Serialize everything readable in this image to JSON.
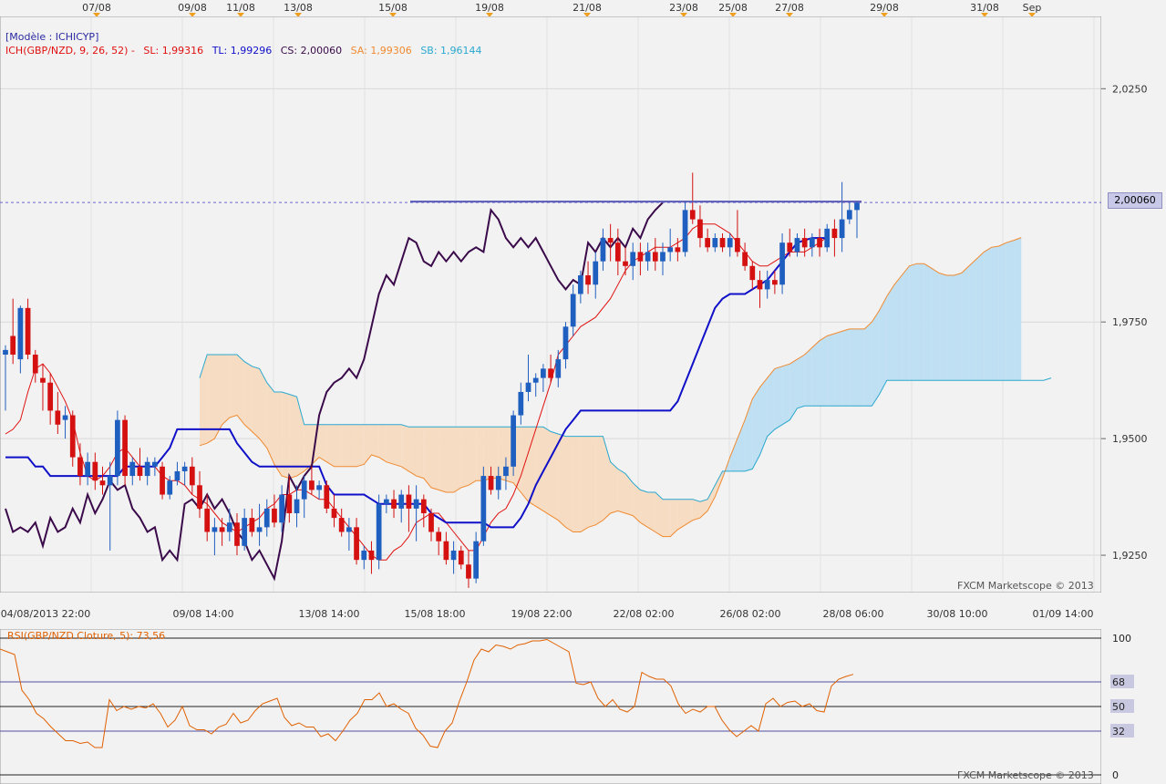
{
  "top_dates": [
    "07/08",
    "09/08",
    "11/08",
    "13/08",
    "15/08",
    "19/08",
    "21/08",
    "23/08",
    "25/08",
    "27/08",
    "29/08",
    "31/08",
    "Sep"
  ],
  "legend": {
    "model": "[Modèle : ICHICYP]",
    "ich": "ICH(GBP/NZD, 9, 26, 52) -",
    "sl": "SL: 1,99316",
    "tl": "TL: 1,99296",
    "cs": "CS: 2,00060",
    "sa": "SA: 1,99306",
    "sb": "SB: 1,96144"
  },
  "price_current": "2,00060",
  "watermark": "FXCM Marketscope © 2013",
  "rsi_label": "RSI(GBP/NZD.Cloture, 5): 73,56",
  "colors": {
    "bull": "#1f5fbf",
    "bear": "#d41010",
    "tenkan": "#e01010",
    "kijun": "#1010c8",
    "chikou": "#3a0a4a",
    "cloud_bull": "#bfe0f2",
    "cloud_bear": "#f6dcc2",
    "span_a": "#f08a30",
    "span_b": "#2aa8cf",
    "rsi": "#e06000"
  },
  "chart_data": {
    "type": "candlestick",
    "instrument": "GBP/NZD",
    "price_ticks": [
      "2,0250",
      "1,9750",
      "1,9500",
      "1,9250"
    ],
    "price_tick_values": [
      2.025,
      1.975,
      1.95,
      1.925
    ],
    "ylim": [
      1.917,
      2.0405
    ],
    "bottom_time_labels": [
      "04/08/2013 22:00",
      "09/08 14:00",
      "13/08 14:00",
      "15/08 18:00",
      "19/08 22:00",
      "22/08 02:00",
      "26/08 02:00",
      "28/08 06:00",
      "30/08 10:00",
      "01/09 14:00"
    ],
    "candles": [
      {
        "o": 1.968,
        "h": 1.97,
        "l": 1.956,
        "c": 1.969
      },
      {
        "o": 1.972,
        "h": 1.98,
        "l": 1.966,
        "c": 1.968
      },
      {
        "o": 1.967,
        "h": 1.9785,
        "l": 1.964,
        "c": 1.978
      },
      {
        "o": 1.978,
        "h": 1.98,
        "l": 1.967,
        "c": 1.968
      },
      {
        "o": 1.968,
        "h": 1.969,
        "l": 1.962,
        "c": 1.964
      },
      {
        "o": 1.963,
        "h": 1.966,
        "l": 1.956,
        "c": 1.962
      },
      {
        "o": 1.962,
        "h": 1.964,
        "l": 1.953,
        "c": 1.956
      },
      {
        "o": 1.956,
        "h": 1.96,
        "l": 1.951,
        "c": 1.953
      },
      {
        "o": 1.954,
        "h": 1.957,
        "l": 1.95,
        "c": 1.955
      },
      {
        "o": 1.955,
        "h": 1.956,
        "l": 1.944,
        "c": 1.946
      },
      {
        "o": 1.946,
        "h": 1.949,
        "l": 1.94,
        "c": 1.942
      },
      {
        "o": 1.942,
        "h": 1.947,
        "l": 1.94,
        "c": 1.945
      },
      {
        "o": 1.945,
        "h": 1.947,
        "l": 1.939,
        "c": 1.941
      },
      {
        "o": 1.941,
        "h": 1.944,
        "l": 1.938,
        "c": 1.94
      },
      {
        "o": 1.94,
        "h": 1.945,
        "l": 1.926,
        "c": 1.942
      },
      {
        "o": 1.942,
        "h": 1.956,
        "l": 1.94,
        "c": 1.954
      },
      {
        "o": 1.954,
        "h": 1.955,
        "l": 1.94,
        "c": 1.942
      },
      {
        "o": 1.942,
        "h": 1.946,
        "l": 1.94,
        "c": 1.945
      },
      {
        "o": 1.944,
        "h": 1.948,
        "l": 1.941,
        "c": 1.942
      },
      {
        "o": 1.942,
        "h": 1.946,
        "l": 1.94,
        "c": 1.945
      },
      {
        "o": 1.944,
        "h": 1.946,
        "l": 1.942,
        "c": 1.945
      },
      {
        "o": 1.944,
        "h": 1.945,
        "l": 1.937,
        "c": 1.938
      },
      {
        "o": 1.938,
        "h": 1.942,
        "l": 1.937,
        "c": 1.941
      },
      {
        "o": 1.941,
        "h": 1.945,
        "l": 1.94,
        "c": 1.943
      },
      {
        "o": 1.943,
        "h": 1.945,
        "l": 1.94,
        "c": 1.944
      },
      {
        "o": 1.944,
        "h": 1.946,
        "l": 1.938,
        "c": 1.94
      },
      {
        "o": 1.94,
        "h": 1.943,
        "l": 1.933,
        "c": 1.935
      },
      {
        "o": 1.935,
        "h": 1.938,
        "l": 1.928,
        "c": 1.93
      },
      {
        "o": 1.93,
        "h": 1.933,
        "l": 1.925,
        "c": 1.931
      },
      {
        "o": 1.931,
        "h": 1.933,
        "l": 1.927,
        "c": 1.93
      },
      {
        "o": 1.93,
        "h": 1.935,
        "l": 1.928,
        "c": 1.932
      },
      {
        "o": 1.932,
        "h": 1.934,
        "l": 1.925,
        "c": 1.927
      },
      {
        "o": 1.927,
        "h": 1.935,
        "l": 1.926,
        "c": 1.933
      },
      {
        "o": 1.933,
        "h": 1.935,
        "l": 1.929,
        "c": 1.93
      },
      {
        "o": 1.93,
        "h": 1.936,
        "l": 1.927,
        "c": 1.931
      },
      {
        "o": 1.931,
        "h": 1.937,
        "l": 1.929,
        "c": 1.935
      },
      {
        "o": 1.935,
        "h": 1.938,
        "l": 1.931,
        "c": 1.932
      },
      {
        "o": 1.932,
        "h": 1.94,
        "l": 1.93,
        "c": 1.938
      },
      {
        "o": 1.938,
        "h": 1.942,
        "l": 1.932,
        "c": 1.934
      },
      {
        "o": 1.934,
        "h": 1.94,
        "l": 1.931,
        "c": 1.937
      },
      {
        "o": 1.937,
        "h": 1.942,
        "l": 1.933,
        "c": 1.941
      },
      {
        "o": 1.941,
        "h": 1.944,
        "l": 1.938,
        "c": 1.939
      },
      {
        "o": 1.939,
        "h": 1.941,
        "l": 1.937,
        "c": 1.94
      },
      {
        "o": 1.94,
        "h": 1.941,
        "l": 1.934,
        "c": 1.935
      },
      {
        "o": 1.935,
        "h": 1.938,
        "l": 1.931,
        "c": 1.933
      },
      {
        "o": 1.933,
        "h": 1.935,
        "l": 1.929,
        "c": 1.93
      },
      {
        "o": 1.93,
        "h": 1.933,
        "l": 1.926,
        "c": 1.931
      },
      {
        "o": 1.931,
        "h": 1.933,
        "l": 1.923,
        "c": 1.924
      },
      {
        "o": 1.924,
        "h": 1.927,
        "l": 1.922,
        "c": 1.926
      },
      {
        "o": 1.926,
        "h": 1.928,
        "l": 1.921,
        "c": 1.924
      },
      {
        "o": 1.924,
        "h": 1.938,
        "l": 1.922,
        "c": 1.936
      },
      {
        "o": 1.936,
        "h": 1.938,
        "l": 1.934,
        "c": 1.937
      },
      {
        "o": 1.937,
        "h": 1.939,
        "l": 1.933,
        "c": 1.935
      },
      {
        "o": 1.935,
        "h": 1.939,
        "l": 1.932,
        "c": 1.938
      },
      {
        "o": 1.938,
        "h": 1.94,
        "l": 1.93,
        "c": 1.935
      },
      {
        "o": 1.935,
        "h": 1.94,
        "l": 1.928,
        "c": 1.937
      },
      {
        "o": 1.937,
        "h": 1.938,
        "l": 1.931,
        "c": 1.934
      },
      {
        "o": 1.934,
        "h": 1.935,
        "l": 1.928,
        "c": 1.93
      },
      {
        "o": 1.93,
        "h": 1.931,
        "l": 1.925,
        "c": 1.928
      },
      {
        "o": 1.928,
        "h": 1.93,
        "l": 1.923,
        "c": 1.924
      },
      {
        "o": 1.924,
        "h": 1.928,
        "l": 1.921,
        "c": 1.926
      },
      {
        "o": 1.926,
        "h": 1.927,
        "l": 1.922,
        "c": 1.923
      },
      {
        "o": 1.923,
        "h": 1.926,
        "l": 1.918,
        "c": 1.92
      },
      {
        "o": 1.92,
        "h": 1.93,
        "l": 1.919,
        "c": 1.928
      },
      {
        "o": 1.928,
        "h": 1.944,
        "l": 1.927,
        "c": 1.942
      },
      {
        "o": 1.942,
        "h": 1.944,
        "l": 1.938,
        "c": 1.939
      },
      {
        "o": 1.939,
        "h": 1.944,
        "l": 1.937,
        "c": 1.942
      },
      {
        "o": 1.942,
        "h": 1.946,
        "l": 1.939,
        "c": 1.944
      },
      {
        "o": 1.944,
        "h": 1.956,
        "l": 1.942,
        "c": 1.955
      },
      {
        "o": 1.955,
        "h": 1.962,
        "l": 1.953,
        "c": 1.96
      },
      {
        "o": 1.96,
        "h": 1.968,
        "l": 1.958,
        "c": 1.962
      },
      {
        "o": 1.962,
        "h": 1.964,
        "l": 1.959,
        "c": 1.963
      },
      {
        "o": 1.963,
        "h": 1.966,
        "l": 1.96,
        "c": 1.965
      },
      {
        "o": 1.965,
        "h": 1.968,
        "l": 1.962,
        "c": 1.963
      },
      {
        "o": 1.963,
        "h": 1.969,
        "l": 1.961,
        "c": 1.967
      },
      {
        "o": 1.967,
        "h": 1.975,
        "l": 1.965,
        "c": 1.974
      },
      {
        "o": 1.974,
        "h": 1.983,
        "l": 1.972,
        "c": 1.981
      },
      {
        "o": 1.981,
        "h": 1.986,
        "l": 1.979,
        "c": 1.985
      },
      {
        "o": 1.985,
        "h": 1.988,
        "l": 1.981,
        "c": 1.983
      },
      {
        "o": 1.983,
        "h": 1.99,
        "l": 1.98,
        "c": 1.988
      },
      {
        "o": 1.988,
        "h": 1.995,
        "l": 1.986,
        "c": 1.993
      },
      {
        "o": 1.993,
        "h": 1.996,
        "l": 1.988,
        "c": 1.992
      },
      {
        "o": 1.992,
        "h": 1.995,
        "l": 1.985,
        "c": 1.988
      },
      {
        "o": 1.988,
        "h": 1.991,
        "l": 1.985,
        "c": 1.987
      },
      {
        "o": 1.987,
        "h": 1.992,
        "l": 1.984,
        "c": 1.99
      },
      {
        "o": 1.99,
        "h": 1.992,
        "l": 1.985,
        "c": 1.988
      },
      {
        "o": 1.988,
        "h": 1.992,
        "l": 1.986,
        "c": 1.99
      },
      {
        "o": 1.99,
        "h": 1.993,
        "l": 1.986,
        "c": 1.988
      },
      {
        "o": 1.988,
        "h": 1.992,
        "l": 1.985,
        "c": 1.99
      },
      {
        "o": 1.99,
        "h": 1.995,
        "l": 1.988,
        "c": 1.991
      },
      {
        "o": 1.991,
        "h": 1.993,
        "l": 1.988,
        "c": 1.99
      },
      {
        "o": 1.99,
        "h": 2.001,
        "l": 1.989,
        "c": 1.999
      },
      {
        "o": 1.999,
        "h": 2.007,
        "l": 1.996,
        "c": 1.997
      },
      {
        "o": 1.997,
        "h": 2.0,
        "l": 1.991,
        "c": 1.993
      },
      {
        "o": 1.993,
        "h": 1.995,
        "l": 1.99,
        "c": 1.991
      },
      {
        "o": 1.991,
        "h": 1.994,
        "l": 1.99,
        "c": 1.993
      },
      {
        "o": 1.993,
        "h": 1.994,
        "l": 1.99,
        "c": 1.991
      },
      {
        "o": 1.991,
        "h": 1.994,
        "l": 1.989,
        "c": 1.993
      },
      {
        "o": 1.993,
        "h": 1.999,
        "l": 1.989,
        "c": 1.99
      },
      {
        "o": 1.99,
        "h": 1.992,
        "l": 1.986,
        "c": 1.987
      },
      {
        "o": 1.987,
        "h": 1.988,
        "l": 1.982,
        "c": 1.984
      },
      {
        "o": 1.984,
        "h": 1.986,
        "l": 1.978,
        "c": 1.982
      },
      {
        "o": 1.982,
        "h": 1.986,
        "l": 1.98,
        "c": 1.984
      },
      {
        "o": 1.984,
        "h": 1.986,
        "l": 1.981,
        "c": 1.983
      },
      {
        "o": 1.983,
        "h": 1.994,
        "l": 1.981,
        "c": 1.992
      },
      {
        "o": 1.992,
        "h": 1.995,
        "l": 1.989,
        "c": 1.99
      },
      {
        "o": 1.99,
        "h": 1.994,
        "l": 1.989,
        "c": 1.993
      },
      {
        "o": 1.993,
        "h": 1.995,
        "l": 1.989,
        "c": 1.991
      },
      {
        "o": 1.991,
        "h": 1.994,
        "l": 1.989,
        "c": 1.993
      },
      {
        "o": 1.993,
        "h": 1.995,
        "l": 1.989,
        "c": 1.991
      },
      {
        "o": 1.991,
        "h": 1.996,
        "l": 1.99,
        "c": 1.995
      },
      {
        "o": 1.995,
        "h": 1.997,
        "l": 1.989,
        "c": 1.993
      },
      {
        "o": 1.993,
        "h": 2.005,
        "l": 1.99,
        "c": 1.997
      },
      {
        "o": 1.997,
        "h": 2.001,
        "l": 1.996,
        "c": 1.999
      },
      {
        "o": 1.999,
        "h": 2.001,
        "l": 1.993,
        "c": 2.0006
      }
    ],
    "tenkan_sen": [
      1.951,
      1.952,
      1.954,
      1.96,
      1.965,
      1.966,
      1.964,
      1.961,
      1.958,
      1.954,
      1.947,
      1.942,
      1.941,
      1.942,
      1.944,
      1.947,
      1.948,
      1.946,
      1.944,
      1.944,
      1.944,
      1.942,
      1.941,
      1.941,
      1.94,
      1.938,
      1.937,
      1.936,
      1.934,
      1.932,
      1.931,
      1.93,
      1.931,
      1.932,
      1.933,
      1.935,
      1.936,
      1.938,
      1.938,
      1.939,
      1.939,
      1.938,
      1.937,
      1.937,
      1.935,
      1.933,
      1.931,
      1.929,
      1.927,
      1.925,
      1.924,
      1.924,
      1.926,
      1.927,
      1.929,
      1.932,
      1.933,
      1.934,
      1.934,
      1.932,
      1.93,
      1.928,
      1.926,
      1.926,
      1.929,
      1.932,
      1.934,
      1.935,
      1.938,
      1.942,
      1.947,
      1.952,
      1.957,
      1.962,
      1.968,
      1.97,
      1.972,
      1.974,
      1.975,
      1.976,
      1.978,
      1.98,
      1.983,
      1.986,
      1.988,
      1.989,
      1.99,
      1.991,
      1.991,
      1.991,
      1.992,
      1.993,
      1.995,
      1.996,
      1.996,
      1.996,
      1.995,
      1.994,
      1.992,
      1.99,
      1.988,
      1.987,
      1.987,
      1.988,
      1.989,
      1.99,
      1.99,
      1.99,
      1.991,
      1.992,
      1.9932
    ],
    "kijun_sen": [
      1.946,
      1.946,
      1.946,
      1.946,
      1.944,
      1.944,
      1.942,
      1.942,
      1.942,
      1.942,
      1.942,
      1.942,
      1.942,
      1.942,
      1.942,
      1.942,
      1.944,
      1.944,
      1.944,
      1.944,
      1.944,
      1.946,
      1.948,
      1.952,
      1.952,
      1.952,
      1.952,
      1.952,
      1.952,
      1.952,
      1.952,
      1.949,
      1.947,
      1.945,
      1.944,
      1.944,
      1.944,
      1.944,
      1.944,
      1.944,
      1.944,
      1.944,
      1.944,
      1.94,
      1.938,
      1.938,
      1.938,
      1.938,
      1.938,
      1.937,
      1.936,
      1.936,
      1.936,
      1.936,
      1.936,
      1.936,
      1.936,
      1.934,
      1.933,
      1.932,
      1.932,
      1.932,
      1.932,
      1.932,
      1.932,
      1.931,
      1.931,
      1.931,
      1.931,
      1.933,
      1.936,
      1.94,
      1.943,
      1.946,
      1.949,
      1.952,
      1.954,
      1.956,
      1.956,
      1.956,
      1.956,
      1.956,
      1.956,
      1.956,
      1.956,
      1.956,
      1.956,
      1.956,
      1.956,
      1.956,
      1.958,
      1.962,
      1.966,
      1.97,
      1.974,
      1.978,
      1.98,
      1.981,
      1.981,
      1.981,
      1.982,
      1.983,
      1.984,
      1.986,
      1.988,
      1.99,
      1.992,
      1.9925,
      1.993,
      1.993,
      1.993
    ]
  },
  "rsi_data": {
    "levels": [
      "100",
      "68",
      "50",
      "32",
      "0"
    ],
    "level_values": [
      100,
      68,
      50,
      32,
      0
    ],
    "current": 73.56,
    "values": [
      92,
      90,
      88,
      62,
      55,
      45,
      41,
      35,
      30,
      25,
      25,
      23,
      24,
      20,
      20,
      55,
      47,
      50,
      48,
      50,
      49,
      52,
      45,
      35,
      40,
      50,
      36,
      33,
      33,
      30,
      35,
      37,
      45,
      38,
      40,
      47,
      52,
      54,
      56,
      42,
      36,
      38,
      35,
      35,
      28,
      30,
      25,
      32,
      40,
      45,
      55,
      55,
      60,
      50,
      52,
      48,
      45,
      34,
      29,
      21,
      20,
      32,
      38,
      54,
      68,
      84,
      92,
      90,
      95,
      94,
      92,
      95,
      96,
      98,
      98,
      99,
      96,
      93,
      90,
      67,
      66,
      68,
      56,
      50,
      55,
      48,
      46,
      50,
      75,
      72,
      70,
      70,
      65,
      52,
      45,
      48,
      46,
      50,
      50,
      40,
      33,
      28,
      32,
      36,
      32,
      52,
      56,
      50,
      53,
      54,
      50,
      52,
      47,
      46,
      65,
      70,
      72,
      73.56
    ]
  }
}
